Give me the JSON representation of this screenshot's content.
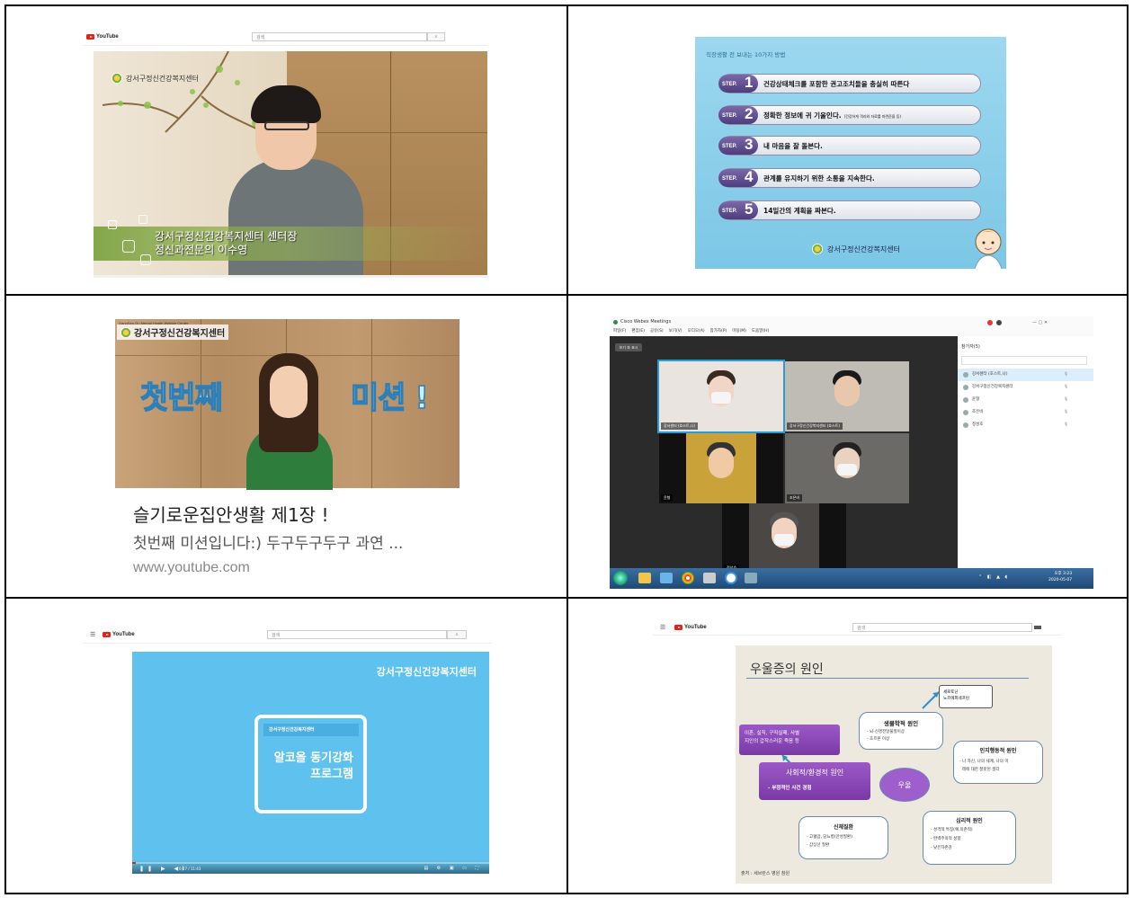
{
  "youtube": {
    "logo": "YouTube",
    "search_placeholder": "검색",
    "search_icon": "🔍"
  },
  "panel1": {
    "org": "강서구정신건강복지센터",
    "caption_line1": "강서구정신건강복지센터 센터장",
    "caption_line2": "정신과전문의   이수영"
  },
  "panel2": {
    "header": "직장생활 전 보내는 10가지 방법",
    "step_word": "STEP.",
    "steps": [
      {
        "num": "1",
        "text": "건강상태체크를 포함한 권고조치들을 충실히 따른다",
        "note": ""
      },
      {
        "num": "2",
        "text": "정확한 정보에 귀 기울인다.",
        "note": "(건강하게 격리와 자료를 마련준을 등)"
      },
      {
        "num": "3",
        "text": "내 마음을 잘 돌본다.",
        "note": ""
      },
      {
        "num": "4",
        "text": "관계를 유지하기 위한 소통을 지속한다.",
        "note": ""
      },
      {
        "num": "5",
        "text": "14일간의 계획을 짜본다.",
        "note": ""
      }
    ],
    "footer": "강서구정신건강복지센터"
  },
  "panel3": {
    "org_en": "GangSeo-Gu Mental Health Welfare Center",
    "org": "강서구정신건강복지센터",
    "mission_left": "첫번째",
    "mission_right": "미션 !",
    "title": "슬기로운집안생활 제1장 !",
    "desc": "첫번째 미션입니다:) 두구두구두구 과연 ...",
    "url": "www.youtube.com"
  },
  "panel4": {
    "window_title": "Cisco Webex Meetings",
    "menu": [
      "파일(F)",
      "편집(E)",
      "공유(S)",
      "보기(V)",
      "오디오(A)",
      "참가자(P)",
      "미팅(M)",
      "도움말(H)"
    ],
    "view_button": "보기 좌 표시",
    "participants_header": "참가자(5)",
    "participants": [
      {
        "name": "강서센터 (호스트,나)",
        "role": ""
      },
      {
        "name": "강서구정신건강복지센터",
        "role": "참가자"
      },
      {
        "name": "윤형",
        "role": ""
      },
      {
        "name": "조은비",
        "role": ""
      },
      {
        "name": "정성호",
        "role": ""
      }
    ],
    "tiles": [
      "강서센터 (호스트,나)",
      "강서구정신건강복지센터 (호스트)",
      "윤형",
      "조은비",
      "정성호"
    ],
    "clock_time": "오후 3:23",
    "clock_date": "2020-05-07"
  },
  "panel5": {
    "org": "강서구정신건강복지센터",
    "card_org": "강서구정신건강복지센터",
    "title_line1": "알코올 동기강화",
    "title_line2": "프로그램",
    "time": "0:07 / 11:43"
  },
  "panel6": {
    "title": "우울증의 원인",
    "serotonin_line1": "세로토닌",
    "serotonin_line2": "노르에피네프린",
    "bio_title": "생물학적 원인",
    "bio_items": [
      "뇌-신경전달물질이상",
      "호르몬 이상"
    ],
    "social_left_line1": "이혼, 실직, 구직실패, 사별",
    "social_left_line2": "지인의 갑작스러운 죽음 등",
    "social_title": "사회적/환경적 원인",
    "social_item": "부정적인 사건 경험",
    "center": "우울",
    "cog_title": "인지행동적 원인",
    "cog_items": [
      "나 자신, 나의 세계, 나의 미",
      "래에 대한 잘못된 생각"
    ],
    "body_title": "신체질환",
    "body_items": [
      "고혈압, 당뇨병(만성질환)",
      "갑상선 질환"
    ],
    "psy_title": "심리적 원인",
    "psy_items": [
      "성격적 특징(예.의존적)",
      "완벽주의적 성향",
      "낮은자존감"
    ],
    "source": "출처 : 세브란스 병원 참원"
  }
}
